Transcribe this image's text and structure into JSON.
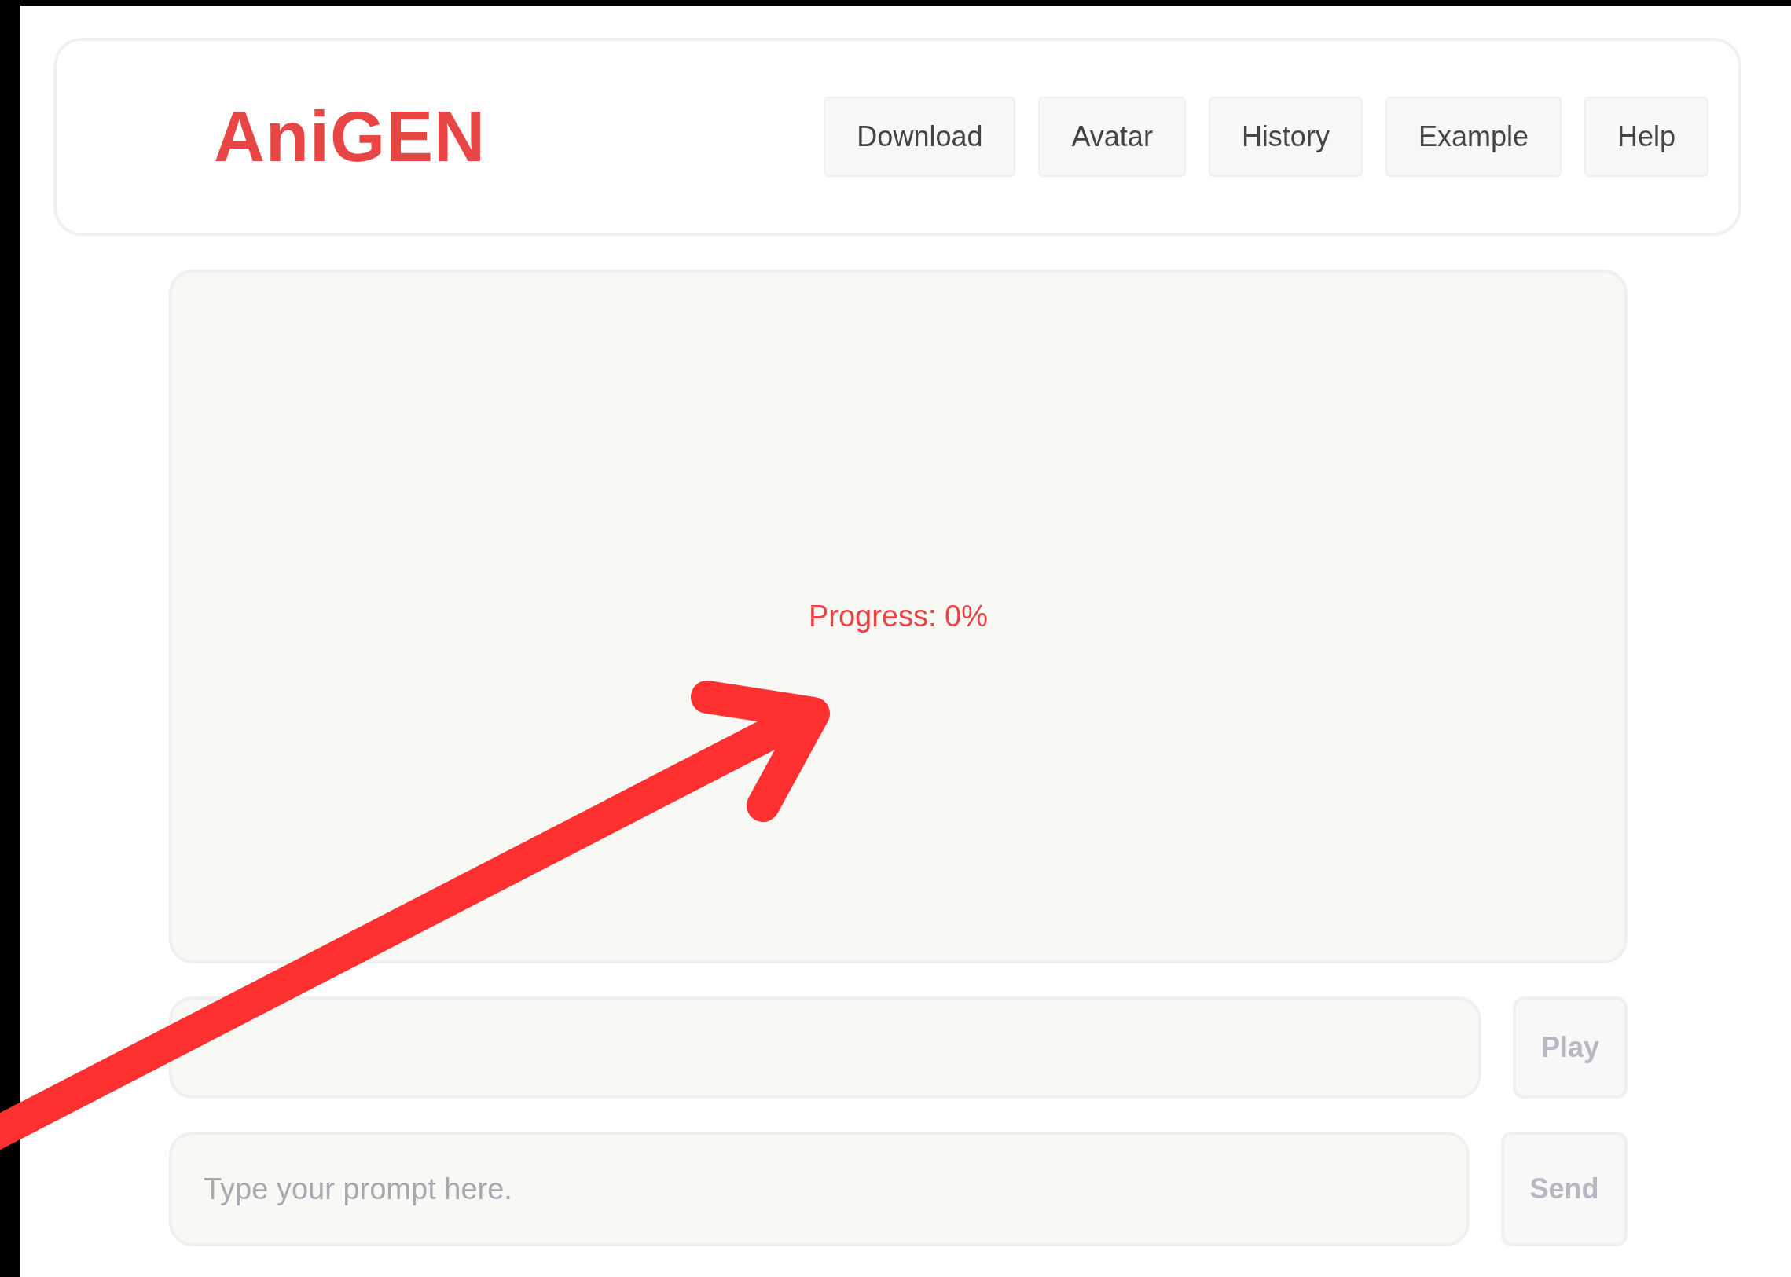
{
  "header": {
    "logo": "AniGEN",
    "nav": [
      "Download",
      "Avatar",
      "History",
      "Example",
      "Help"
    ]
  },
  "player": {
    "progress": "Progress: 0%"
  },
  "controls": {
    "play_button": "Play",
    "prompt": {
      "placeholder": "Type your prompt here."
    },
    "send_button": "Send"
  }
}
